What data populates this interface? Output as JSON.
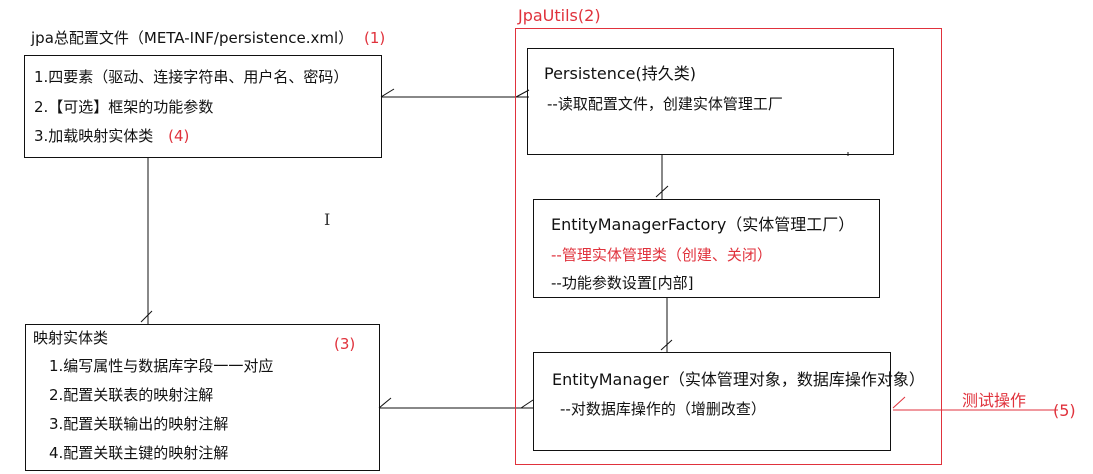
{
  "config": {
    "title": "jpa总配置文件（META-INF/persistence.xml）",
    "title_tag": "(1)",
    "items": [
      "1.四要素（驱动、连接字符串、用户名、密码）",
      "2.【可选】框架的功能参数",
      "3.加载映射实体类"
    ],
    "items_tag": "(4)"
  },
  "entity": {
    "title": "映射实体类",
    "tag": "(3)",
    "items": [
      "1.编写属性与数据库字段一一对应",
      "2.配置关联表的映射注解",
      "3.配置关联输出的映射注解",
      "4.配置关联主键的映射注解"
    ]
  },
  "jpautils": {
    "title": "JpaUtils(2)"
  },
  "persistence": {
    "title": "Persistence(持久类)",
    "desc": "--读取配置文件，创建实体管理工厂"
  },
  "factory": {
    "title": "EntityManagerFactory（实体管理工厂）",
    "desc_red": "--管理实体管理类（创建、关闭）",
    "desc": "--功能参数设置[内部]"
  },
  "manager": {
    "title": "EntityManager（实体管理对象，数据库操作对象）",
    "desc": "--对数据库操作的（增删改查）"
  },
  "test": {
    "label": "测试操作",
    "tag": "(5)"
  },
  "colors": {
    "red": "#e0323c",
    "line": "#111111"
  },
  "cursor_glyph": "I"
}
